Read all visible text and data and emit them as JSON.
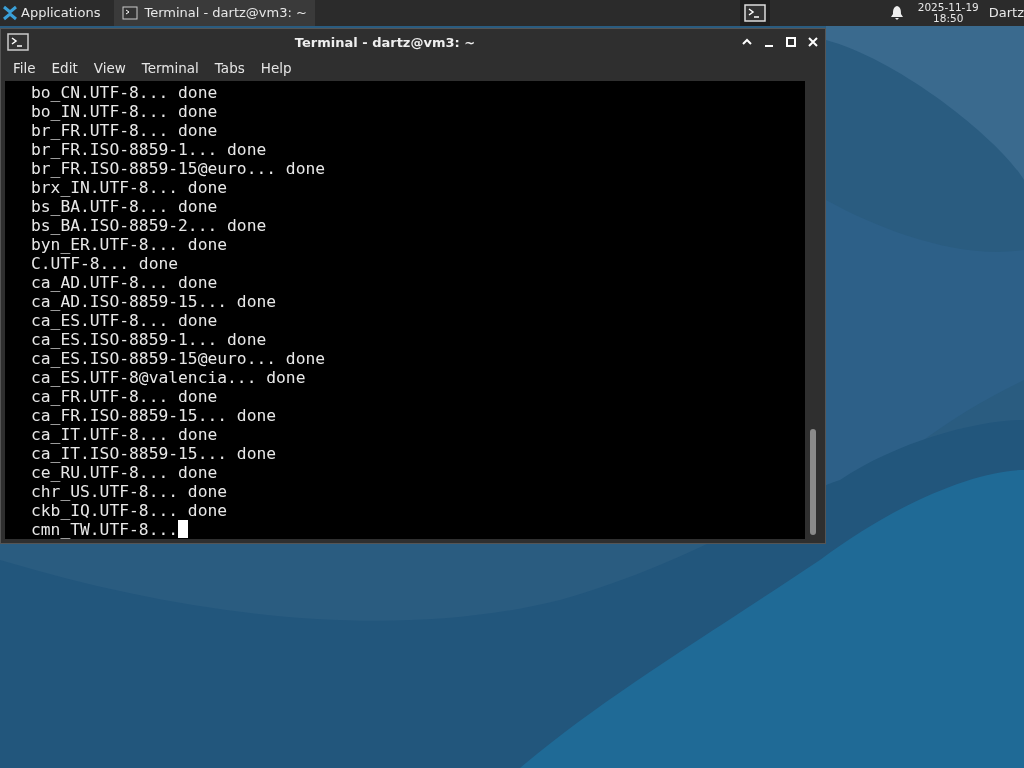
{
  "panel": {
    "applications_label": "Applications",
    "tasks": [
      {
        "title": "Terminal - dartz@vm3: ~",
        "selected": true
      }
    ],
    "clock": {
      "date": "2025-11-19",
      "time": "18:50"
    },
    "user": "Dartz"
  },
  "window": {
    "title": "Terminal - dartz@vm3: ~",
    "menu": [
      "File",
      "Edit",
      "View",
      "Terminal",
      "Tabs",
      "Help"
    ]
  },
  "terminal": {
    "lines": [
      "bo_CN.UTF-8... done",
      "bo_IN.UTF-8... done",
      "br_FR.UTF-8... done",
      "br_FR.ISO-8859-1... done",
      "br_FR.ISO-8859-15@euro... done",
      "brx_IN.UTF-8... done",
      "bs_BA.UTF-8... done",
      "bs_BA.ISO-8859-2... done",
      "byn_ER.UTF-8... done",
      "C.UTF-8... done",
      "ca_AD.UTF-8... done",
      "ca_AD.ISO-8859-15... done",
      "ca_ES.UTF-8... done",
      "ca_ES.ISO-8859-1... done",
      "ca_ES.ISO-8859-15@euro... done",
      "ca_ES.UTF-8@valencia... done",
      "ca_FR.UTF-8... done",
      "ca_FR.ISO-8859-15... done",
      "ca_IT.UTF-8... done",
      "ca_IT.ISO-8859-15... done",
      "ce_RU.UTF-8... done",
      "chr_US.UTF-8... done",
      "ckb_IQ.UTF-8... done",
      "cmn_TW.UTF-8..."
    ]
  }
}
